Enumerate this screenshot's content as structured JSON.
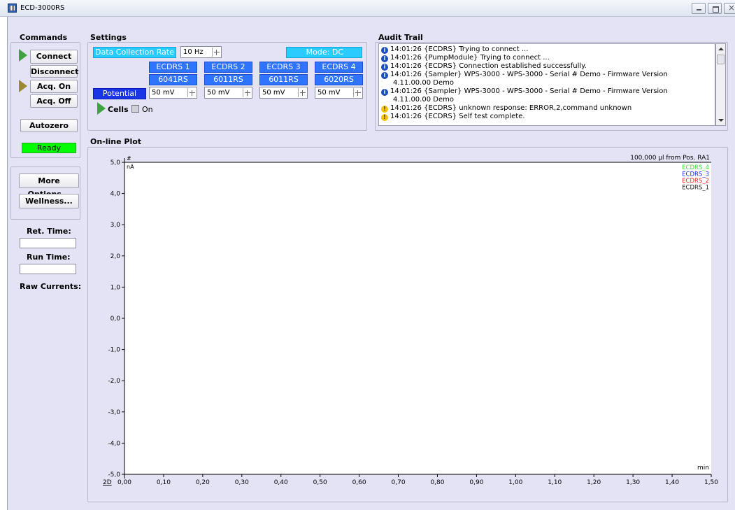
{
  "window": {
    "title": "ECD-3000RS"
  },
  "commands": {
    "title": "Commands",
    "connect": "Connect",
    "disconnect": "Disconnect",
    "acq_on": "Acq. On",
    "acq_off": "Acq. Off",
    "autozero": "Autozero",
    "status": "Ready",
    "more_options": "More Options...",
    "wellness": "Wellness...",
    "ret_time_label": "Ret. Time:",
    "ret_time_value": "",
    "run_time_label": "Run Time:",
    "run_time_value": "",
    "raw_currents_label": "Raw Currents:"
  },
  "settings": {
    "title": "Settings",
    "data_collection_rate_label": "Data Collection Rate",
    "data_collection_rate_value": "10 Hz",
    "mode": "Mode: DC",
    "potential_label": "Potential",
    "channels": [
      {
        "name": "ECDRS 1",
        "model": "6041RS",
        "potential": "50 mV"
      },
      {
        "name": "ECDRS 2",
        "model": "6011RS",
        "potential": "50 mV"
      },
      {
        "name": "ECDRS 3",
        "model": "6011RS",
        "potential": "50 mV"
      },
      {
        "name": "ECDRS 4",
        "model": "6020RS",
        "potential": "50 mV"
      }
    ],
    "cells_label": "Cells",
    "on_label": "On"
  },
  "audit": {
    "title": "Audit Trail",
    "entries": [
      {
        "icon": "info",
        "text": "14:01:26 {ECDRS} Trying to connect ..."
      },
      {
        "icon": "info",
        "text": "14:01:26 {PumpModule} Trying to connect ..."
      },
      {
        "icon": "info",
        "text": "14:01:26 {ECDRS} Connection established successfully."
      },
      {
        "icon": "info",
        "text": "14:01:26 {Sampler} WPS-3000 - WPS-3000 - Serial # Demo - Firmware Version"
      },
      {
        "icon": "none",
        "text": "4.11.00.00 Demo"
      },
      {
        "icon": "info",
        "text": "14:01:26 {Sampler} WPS-3000 - WPS-3000 - Serial # Demo - Firmware Version"
      },
      {
        "icon": "none",
        "text": "4.11.00.00 Demo"
      },
      {
        "icon": "warn",
        "text": "14:01:26 {ECDRS} unknown response: ERROR,2,command unknown"
      },
      {
        "icon": "warn",
        "text": "14:01:26 {ECDRS} Self test complete."
      }
    ]
  },
  "plot": {
    "title": "On-line Plot",
    "annotation": "100,000 µl from Pos. RA1",
    "mode_label": "2D",
    "chart_data": {
      "type": "line",
      "ylabel_top": "#",
      "ylabel": "nA",
      "xlabel": "min",
      "ylim": [
        -5.0,
        5.0
      ],
      "xlim": [
        0.0,
        1.5
      ],
      "yticks": [
        "5,0",
        "4,0",
        "3,0",
        "2,0",
        "1,0",
        "0,0",
        "-1,0",
        "-2,0",
        "-3,0",
        "-4,0",
        "-5,0"
      ],
      "xticks": [
        "0,00",
        "0,10",
        "0,20",
        "0,30",
        "0,40",
        "0,50",
        "0,60",
        "0,70",
        "0,80",
        "0,90",
        "1,00",
        "1,10",
        "1,20",
        "1,30",
        "1,40",
        "1,50"
      ],
      "series": [
        {
          "name": "ECDRS_4",
          "color": "#33dd33",
          "values": []
        },
        {
          "name": "ECDRS_3",
          "color": "#2222ee",
          "values": []
        },
        {
          "name": "ECDRS_2",
          "color": "#ee2222",
          "values": []
        },
        {
          "name": "ECDRS_1",
          "color": "#222222",
          "values": []
        }
      ]
    }
  }
}
